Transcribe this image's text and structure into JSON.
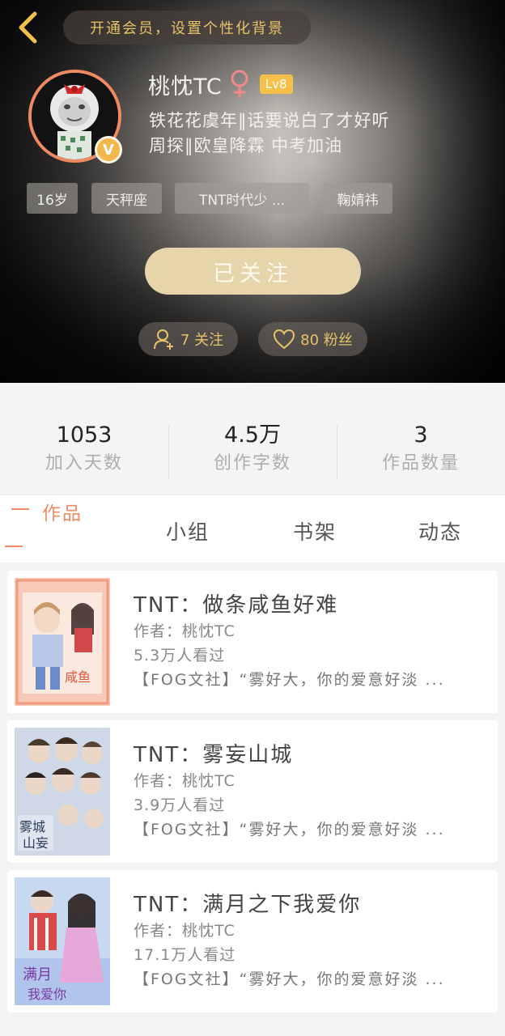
{
  "header": {
    "vip_prompt": "开通会员，设置个性化背景",
    "username": "桃忱TC",
    "level": "Lv8",
    "bio_line1": "铁花花虞年‖话要说白了才好听",
    "bio_line2": "周探‖欧皇降霖 中考加油",
    "tags": [
      "16岁",
      "天秤座",
      "TNT时代少 ...",
      "鞠婧祎"
    ],
    "follow_button": "已关注",
    "following_text": "7 关注",
    "fans_text": "80 粉丝",
    "badge_letter": "V"
  },
  "stats": [
    {
      "value": "1053",
      "label": "加入天数"
    },
    {
      "value": "4.5万",
      "label": "创作字数"
    },
    {
      "value": "3",
      "label": "作品数量"
    }
  ],
  "tabs": [
    "作品",
    "小组",
    "书架",
    "动态"
  ],
  "works": [
    {
      "title": "TNT：做条咸鱼好难",
      "author": "作者：桃忱TC",
      "views": "5.3万人看过",
      "desc": "【FOG文社】“雾好大，你的爱意好淡 ..."
    },
    {
      "title": "TNT：雾妄山城",
      "author": "作者：桃忱TC",
      "views": "3.9万人看过",
      "desc": "【FOG文社】“雾好大，你的爱意好淡 ..."
    },
    {
      "title": "TNT：满月之下我爱你",
      "author": "作者：桃忱TC",
      "views": "17.1万人看过",
      "desc": "【FOG文社】“雾好大，你的爱意好淡 ..."
    }
  ],
  "colors": {
    "accent": "#f08a63",
    "gold": "#e8c26a",
    "follow_button_bg": "#e6d5ab",
    "level_badge": "#f4c04a"
  }
}
